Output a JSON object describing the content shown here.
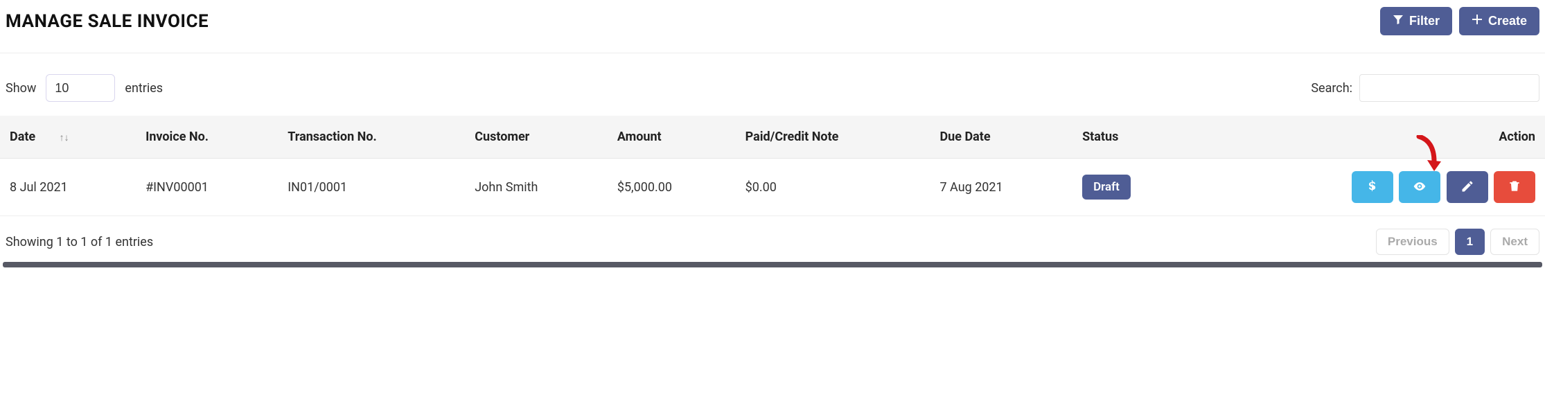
{
  "header": {
    "title": "MANAGE SALE INVOICE",
    "filter_label": "Filter",
    "create_label": "Create"
  },
  "controls": {
    "show_label": "Show",
    "entries_label": "entries",
    "page_size_value": "10",
    "search_label": "Search:",
    "search_value": ""
  },
  "table": {
    "columns": {
      "date": "Date",
      "invoice_no": "Invoice No.",
      "transaction_no": "Transaction No.",
      "customer": "Customer",
      "amount": "Amount",
      "paid": "Paid/Credit Note",
      "due_date": "Due Date",
      "status": "Status",
      "action": "Action"
    },
    "rows": [
      {
        "date": "8 Jul 2021",
        "invoice_no": "#INV00001",
        "transaction_no": "IN01/0001",
        "customer": "John Smith",
        "amount": "$5,000.00",
        "paid": "$0.00",
        "due_date": "7 Aug 2021",
        "status": "Draft"
      }
    ]
  },
  "footer": {
    "info": "Showing 1 to 1 of 1 entries",
    "prev": "Previous",
    "page": "1",
    "next": "Next"
  }
}
